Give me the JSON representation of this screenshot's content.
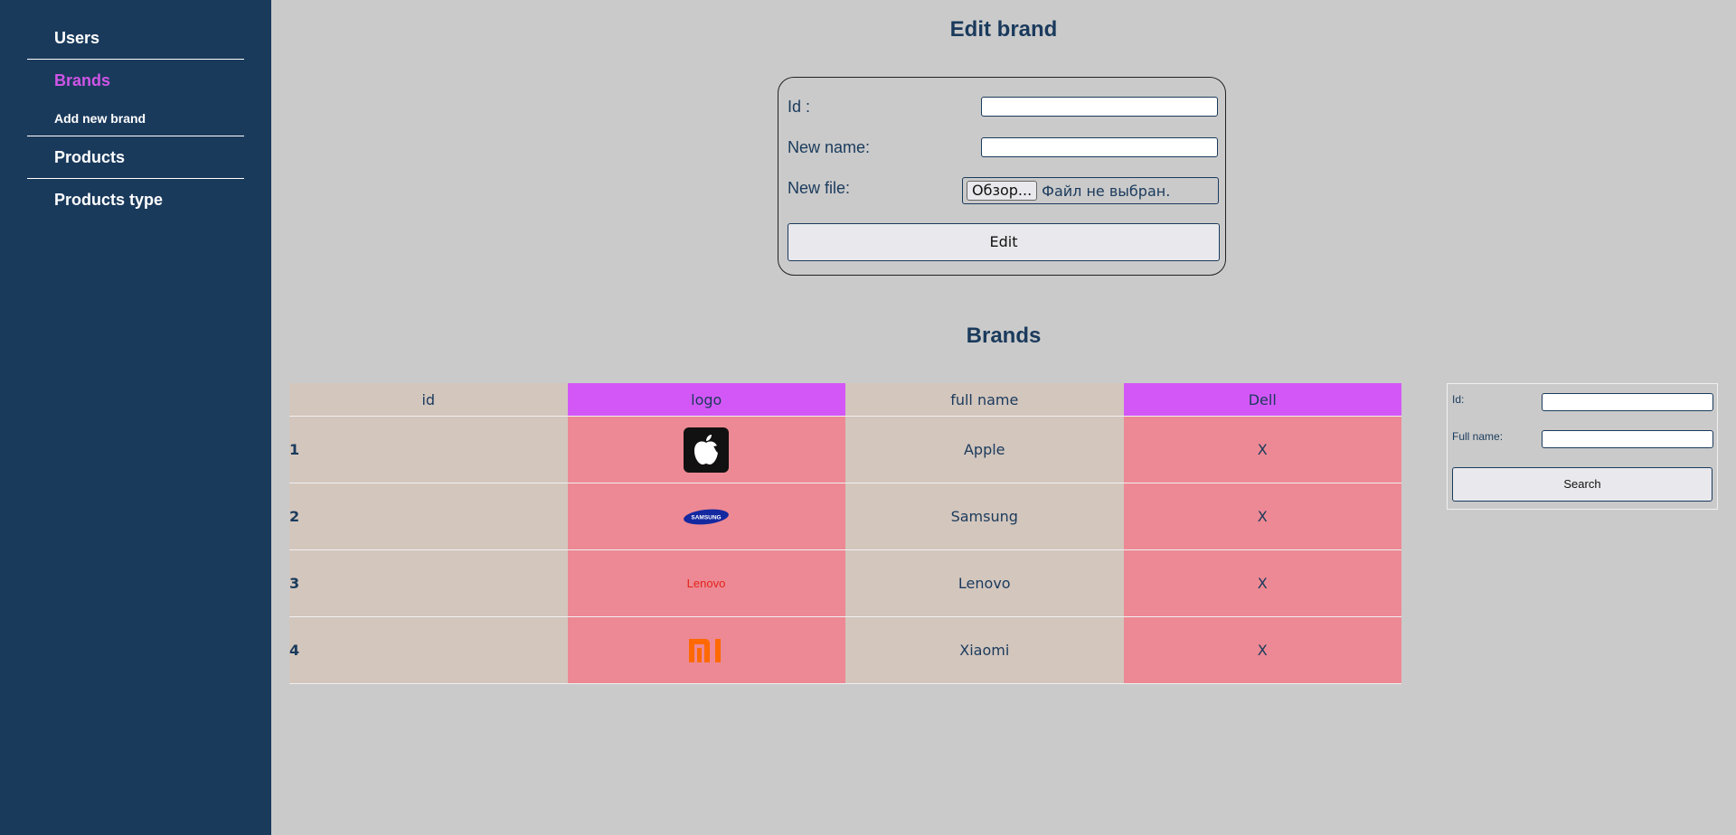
{
  "sidebar": {
    "users": "Users",
    "brands": "Brands",
    "add_brand": "Add new brand",
    "products": "Products",
    "products_type": "Products type"
  },
  "edit_form": {
    "title": "Edit brand",
    "id_label": "Id :",
    "name_label": "New name:",
    "file_label": "New file:",
    "file_button": "Обзор...",
    "file_status": "Файл не выбран.",
    "submit": "Edit"
  },
  "brands_table": {
    "title": "Brands",
    "columns": [
      "id",
      "logo",
      "full name",
      "Dell"
    ],
    "rows": [
      {
        "id": "1",
        "logo": "apple-logo",
        "name": "Apple",
        "action": "X"
      },
      {
        "id": "2",
        "logo": "samsung-logo",
        "name": "Samsung",
        "action": "X"
      },
      {
        "id": "3",
        "logo": "lenovo-logo",
        "name": "Lenovo",
        "action": "X"
      },
      {
        "id": "4",
        "logo": "xiaomi-logo",
        "name": "Xiaomi",
        "action": "X"
      }
    ]
  },
  "logos": {
    "samsung_text": "SAMSUNG",
    "lenovo_text": "Lenovo"
  },
  "search": {
    "id_label": "Id:",
    "name_label": "Full name:",
    "button": "Search"
  },
  "colors": {
    "sidebar": "#1a3a5c",
    "accent": "#cf55e6",
    "background": "#cacaca",
    "beige_column": "#d3c6bd",
    "pink_column": "#ec8994",
    "pink_header": "#d357f6"
  }
}
